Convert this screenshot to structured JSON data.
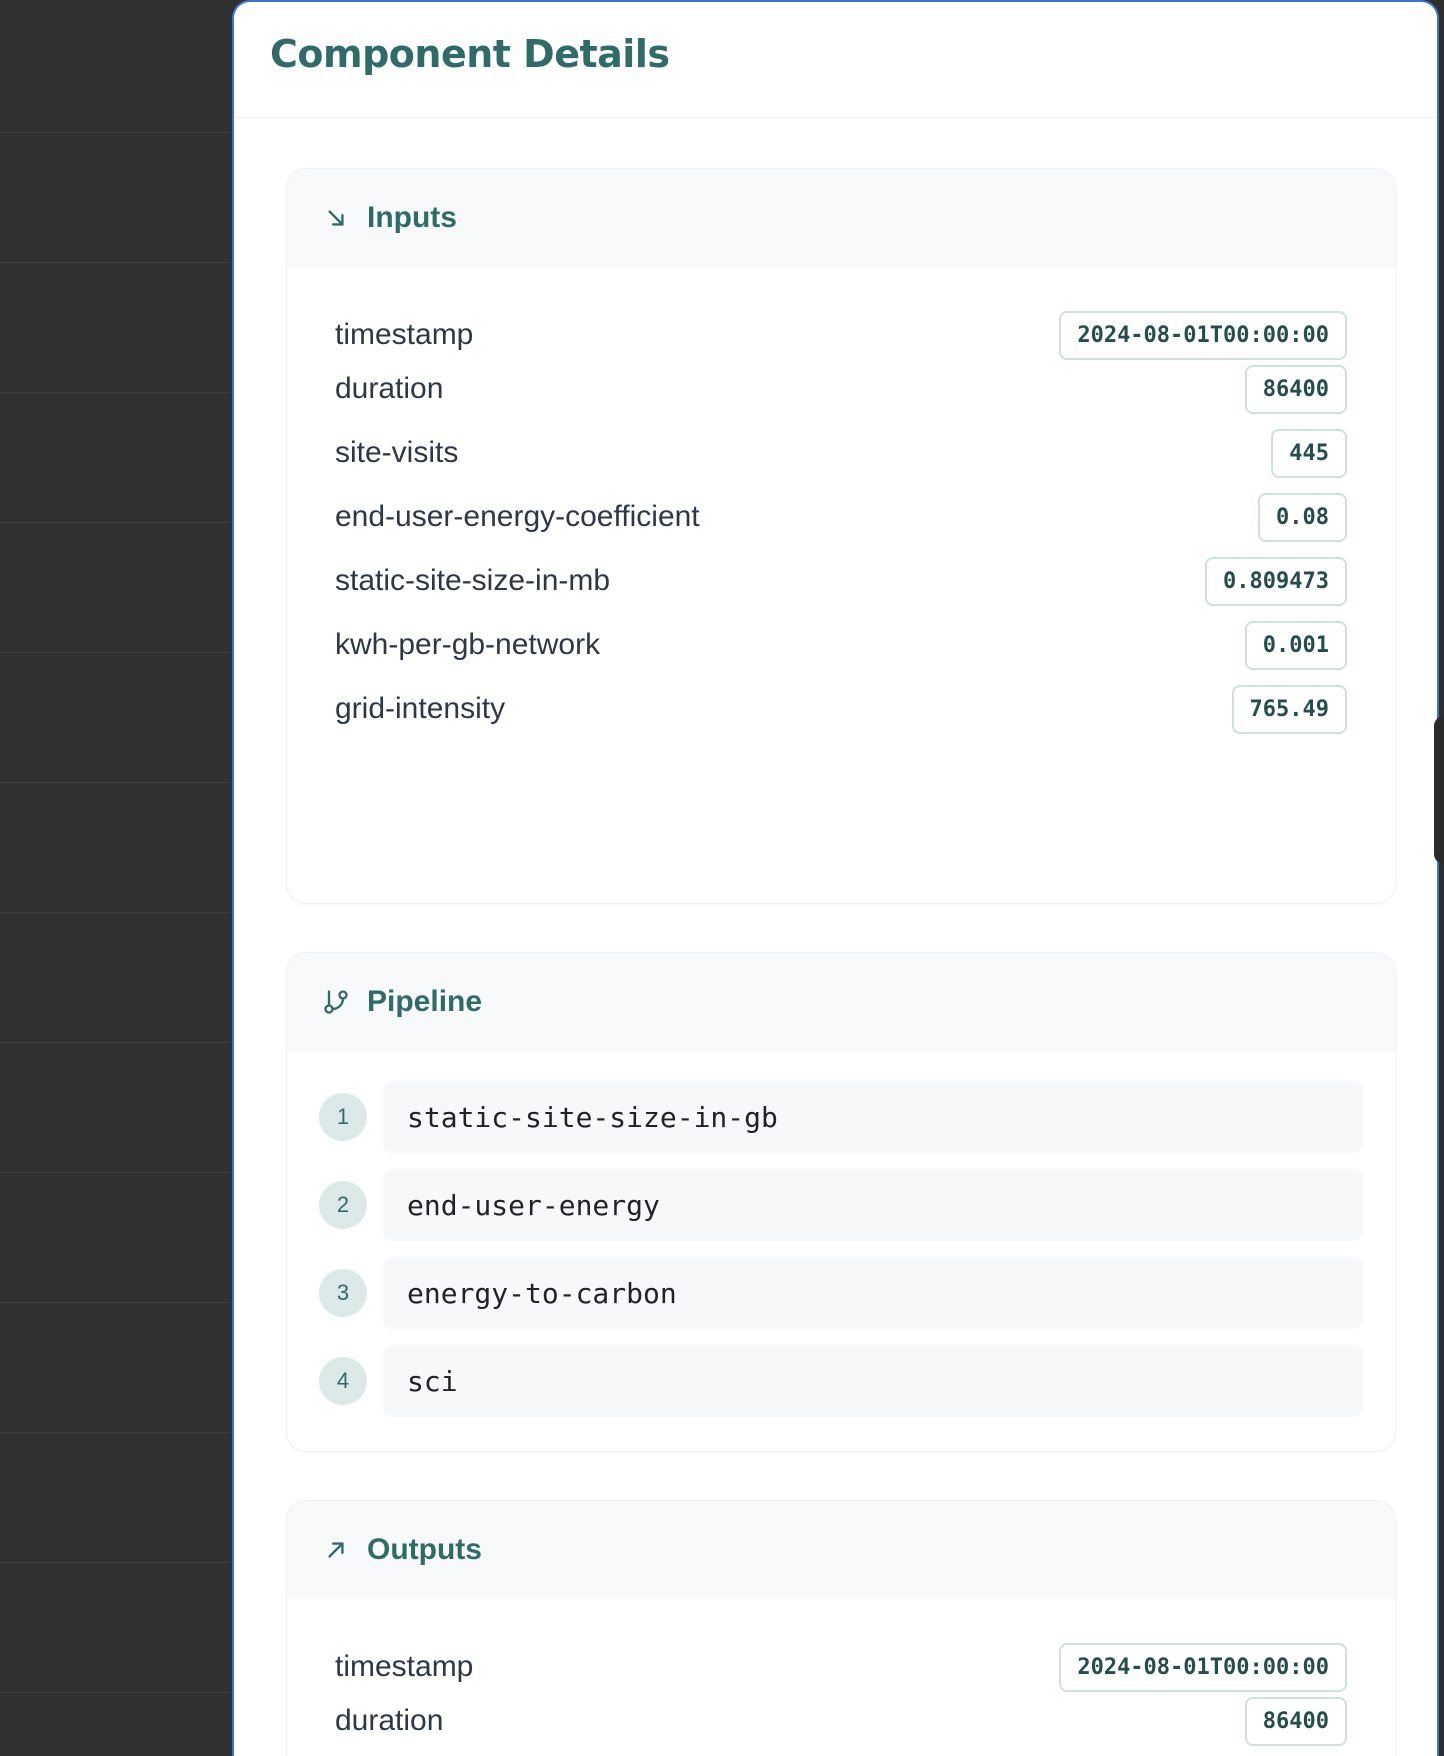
{
  "panel": {
    "title": "Component Details"
  },
  "inputs": {
    "title": "Inputs",
    "icon": "arrow-down-right-icon",
    "rows": [
      {
        "label": "timestamp",
        "value": "2024-08-01T00:00:00"
      },
      {
        "label": "duration",
        "value": "86400"
      },
      {
        "label": "site-visits",
        "value": "445"
      },
      {
        "label": "end-user-energy-coefficient",
        "value": "0.08"
      },
      {
        "label": "static-site-size-in-mb",
        "value": "0.809473"
      },
      {
        "label": "kwh-per-gb-network",
        "value": "0.001"
      },
      {
        "label": "grid-intensity",
        "value": "765.49"
      }
    ]
  },
  "pipeline": {
    "title": "Pipeline",
    "icon": "git-branch-icon",
    "steps": [
      {
        "num": "1",
        "name": "static-site-size-in-gb"
      },
      {
        "num": "2",
        "name": "end-user-energy"
      },
      {
        "num": "3",
        "name": "energy-to-carbon"
      },
      {
        "num": "4",
        "name": "sci"
      }
    ]
  },
  "outputs": {
    "title": "Outputs",
    "icon": "arrow-up-right-icon",
    "rows": [
      {
        "label": "timestamp",
        "value": "2024-08-01T00:00:00"
      },
      {
        "label": "duration",
        "value": "86400"
      }
    ]
  },
  "colors": {
    "accent": "#2f6b68",
    "panel_border": "#3b73d6",
    "backdrop": "#303030"
  }
}
